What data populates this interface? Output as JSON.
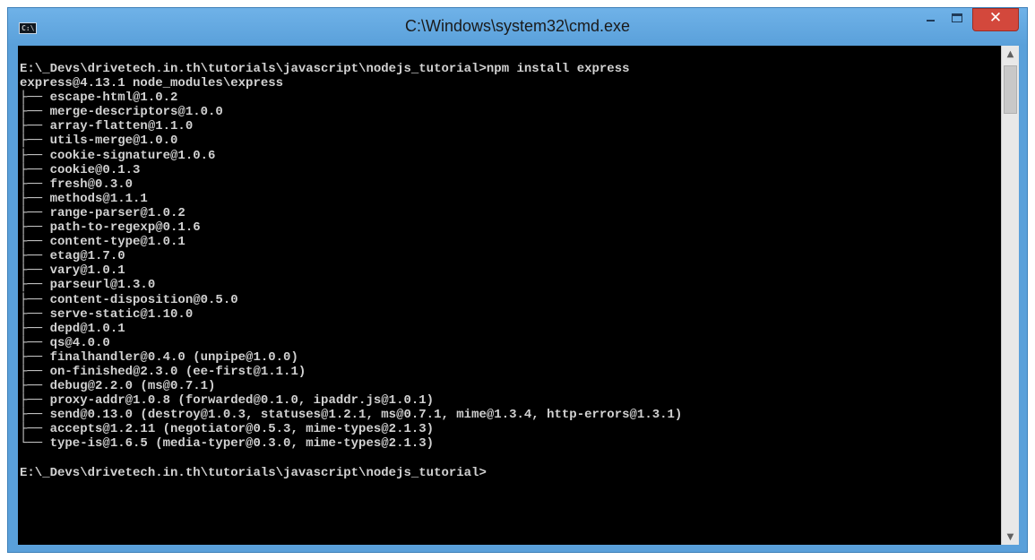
{
  "window": {
    "title": "C:\\Windows\\system32\\cmd.exe",
    "icon_text": "C:\\",
    "close_glyph": "✕",
    "scroll_up_glyph": "▲",
    "scroll_down_glyph": "▼",
    "colors": {
      "frame": "#5aa0da",
      "close": "#d3483c",
      "console_bg": "#000000",
      "console_fg": "#d2d2d2"
    }
  },
  "console": {
    "lines": [
      "E:\\_Devs\\drivetech.in.th\\tutorials\\javascript\\nodejs_tutorial>npm install express",
      "express@4.13.1 node_modules\\express",
      "├── escape-html@1.0.2",
      "├── merge-descriptors@1.0.0",
      "├── array-flatten@1.1.0",
      "├── utils-merge@1.0.0",
      "├── cookie-signature@1.0.6",
      "├── cookie@0.1.3",
      "├── fresh@0.3.0",
      "├── methods@1.1.1",
      "├── range-parser@1.0.2",
      "├── path-to-regexp@0.1.6",
      "├── content-type@1.0.1",
      "├── etag@1.7.0",
      "├── vary@1.0.1",
      "├── parseurl@1.3.0",
      "├── content-disposition@0.5.0",
      "├── serve-static@1.10.0",
      "├── depd@1.0.1",
      "├── qs@4.0.0",
      "├── finalhandler@0.4.0 (unpipe@1.0.0)",
      "├── on-finished@2.3.0 (ee-first@1.1.1)",
      "├── debug@2.2.0 (ms@0.7.1)",
      "├── proxy-addr@1.0.8 (forwarded@0.1.0, ipaddr.js@1.0.1)",
      "├── send@0.13.0 (destroy@1.0.3, statuses@1.2.1, ms@0.7.1, mime@1.3.4, http-errors@1.3.1)",
      "├── accepts@1.2.11 (negotiator@0.5.3, mime-types@2.1.3)",
      "└── type-is@1.6.5 (media-typer@0.3.0, mime-types@2.1.3)",
      "",
      "E:\\_Devs\\drivetech.in.th\\tutorials\\javascript\\nodejs_tutorial>"
    ]
  }
}
